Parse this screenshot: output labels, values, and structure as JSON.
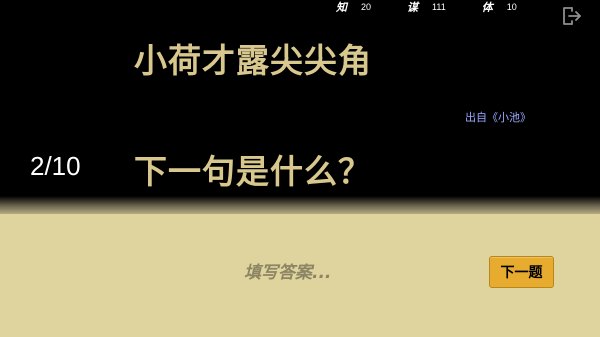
{
  "stats": [
    {
      "label": "知",
      "value": "20"
    },
    {
      "label": "谋",
      "value": "111"
    },
    {
      "label": "体",
      "value": "10"
    }
  ],
  "exit_icon": "exit-icon",
  "poem": {
    "line": "小荷才露尖尖角",
    "source": "出自《小池》"
  },
  "progress": {
    "counter": "2/10"
  },
  "question": "下一句是什么？",
  "answer": {
    "value": "",
    "placeholder": "填写答案..."
  },
  "buttons": {
    "next_label": "下一题"
  },
  "colors": {
    "accent_text": "#d8c88e",
    "source_text": "#9aa8ff",
    "panel": "#e0d49e",
    "button": "#e7ac2f"
  }
}
